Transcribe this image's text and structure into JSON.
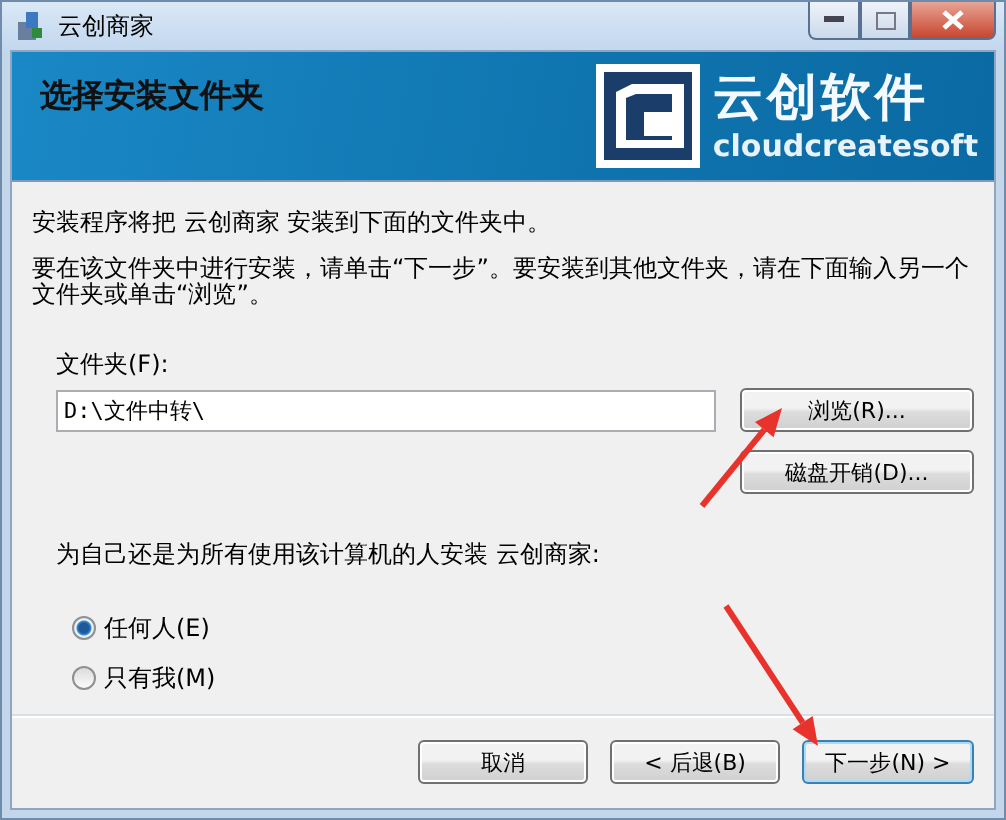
{
  "window": {
    "title": "云创商家"
  },
  "banner": {
    "heading": "选择安装文件夹",
    "logo_name": "云创软件",
    "logo_subtitle": "cloudcreatesoft"
  },
  "intro": "安装程序将把 云创商家 安装到下面的文件夹中。",
  "instructions": "要在该文件夹中进行安装，请单击“下一步”。要安装到其他文件夹，请在下面输入另一个文件夹或单击“浏览”。",
  "folder": {
    "label": "文件夹(F):",
    "value": "D:\\文件中转\\"
  },
  "folder_buttons": [
    "浏览(R)...",
    "磁盘开销(D)..."
  ],
  "scope": {
    "question": "为自己还是为所有使用该计算机的人安装 云创商家:",
    "options": [
      {
        "label": "任何人(E)",
        "selected": true
      },
      {
        "label": "只有我(M)",
        "selected": false
      }
    ]
  },
  "buttons": [
    {
      "label": "取消",
      "default": false
    },
    {
      "label": "< 后退(B)",
      "default": false
    },
    {
      "label": "下一步(N) >",
      "default": true
    }
  ]
}
